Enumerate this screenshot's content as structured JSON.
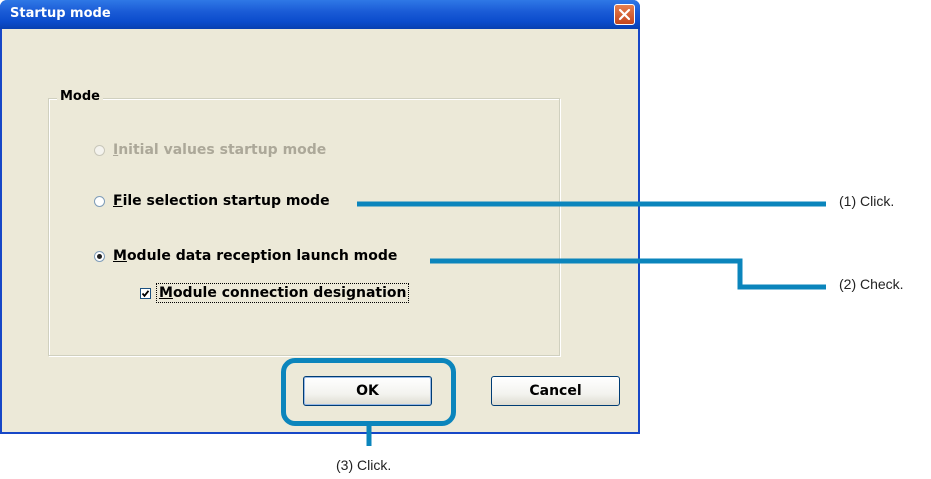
{
  "dialog": {
    "title": "Startup mode",
    "close_icon": "close-icon",
    "group_label": "Mode",
    "options": [
      {
        "label_accel": "I",
        "label_rest": "nitial values startup mode",
        "selected": false,
        "disabled": true
      },
      {
        "label_accel": "F",
        "label_rest": "ile selection startup mode",
        "selected": false,
        "disabled": false
      },
      {
        "label_accel": "M",
        "label_rest": "odule data reception launch mode",
        "selected": true,
        "disabled": false
      }
    ],
    "checkbox": {
      "label_accel": "M",
      "label_rest": "odule connection designation",
      "checked": true
    },
    "ok_label": "OK",
    "cancel_label": "Cancel"
  },
  "annotations": {
    "step1": "(1) Click.",
    "step2": "(2) Check.",
    "step3": "(3) Click.",
    "accent_color": "#0b85bc"
  },
  "colors": {
    "titlebar": "#0b4ccc",
    "dialog_bg": "#ece9d8",
    "disabled_text": "#aca899"
  }
}
